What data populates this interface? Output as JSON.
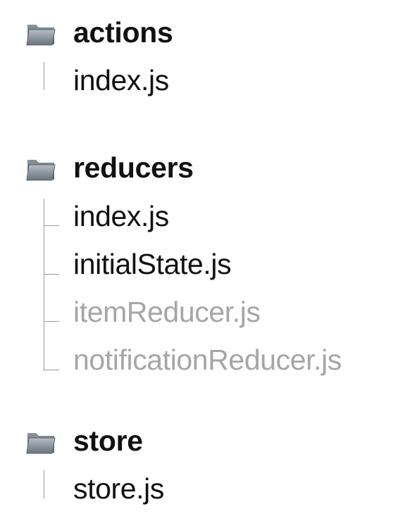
{
  "folders": [
    {
      "name": "actions",
      "icon": "folder-icon",
      "files": [
        {
          "name": "index.js",
          "muted": false
        }
      ]
    },
    {
      "name": "reducers",
      "icon": "folder-icon",
      "files": [
        {
          "name": "index.js",
          "muted": false
        },
        {
          "name": "initialState.js",
          "muted": false
        },
        {
          "name": "itemReducer.js",
          "muted": true
        },
        {
          "name": "notificationReducer.js",
          "muted": true
        }
      ]
    },
    {
      "name": "store",
      "icon": "folder-icon",
      "files": [
        {
          "name": "store.js",
          "muted": false
        }
      ]
    }
  ],
  "colors": {
    "text": "#111111",
    "muted_text": "#a6a6a6",
    "folder_icon": "#7f8a94",
    "tree_line": "#9a9a9a"
  }
}
